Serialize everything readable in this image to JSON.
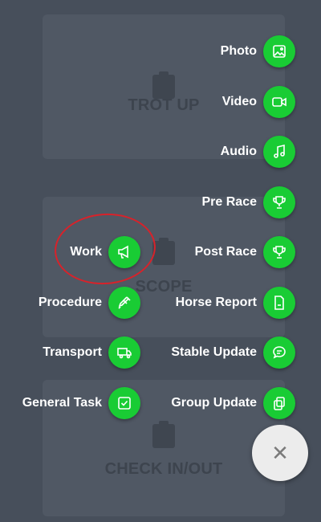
{
  "background_cards": [
    {
      "label": "TROT UP"
    },
    {
      "label": "SCOPE"
    },
    {
      "label": "CHECK IN/OUT"
    }
  ],
  "right_actions": [
    {
      "label": "Photo",
      "icon": "photo-icon"
    },
    {
      "label": "Video",
      "icon": "video-camera-icon"
    },
    {
      "label": "Audio",
      "icon": "music-note-icon"
    },
    {
      "label": "Pre Race",
      "icon": "trophy-icon"
    },
    {
      "label": "Post Race",
      "icon": "trophy-icon"
    },
    {
      "label": "Horse Report",
      "icon": "document-icon"
    },
    {
      "label": "Stable Update",
      "icon": "chat-bubble-icon"
    },
    {
      "label": "Group Update",
      "icon": "copy-icon"
    }
  ],
  "left_actions": [
    {
      "label": "Work",
      "icon": "megaphone-icon"
    },
    {
      "label": "Procedure",
      "icon": "syringe-icon"
    },
    {
      "label": "Transport",
      "icon": "truck-icon"
    },
    {
      "label": "General Task",
      "icon": "checkbox-icon"
    }
  ],
  "close_button": {
    "symbol": "✕"
  },
  "colors": {
    "background": "#474f5b",
    "action_green": "#19cc34",
    "close_fab": "#ececec",
    "highlight": "#d8222a"
  }
}
